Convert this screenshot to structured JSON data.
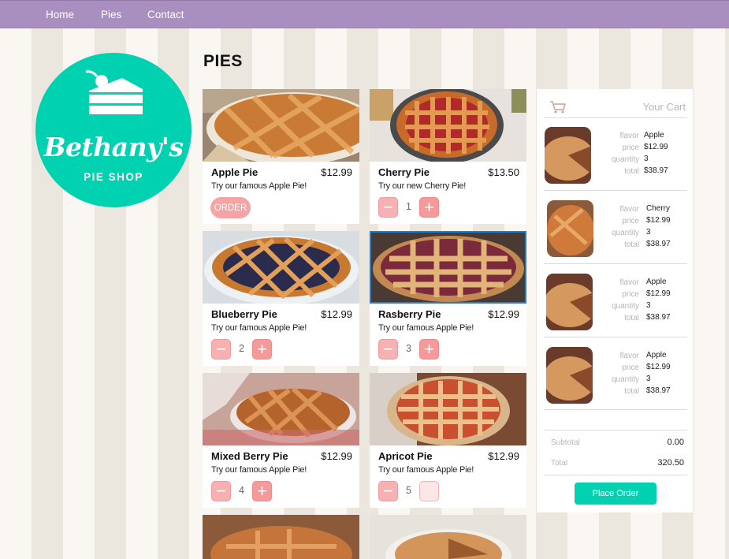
{
  "nav": {
    "home": "Home",
    "pies": "Pies",
    "contact": "Contact"
  },
  "logo": {
    "name": "Bethany's",
    "subtitle": "PIE SHOP"
  },
  "page_title": "PIES",
  "products": [
    {
      "name": "Apple Pie",
      "price": "$12.99",
      "desc": "Try our famous Apple Pie!",
      "action": "ORDER"
    },
    {
      "name": "Cherry Pie",
      "price": "$13.50",
      "desc": "Try our new Cherry Pie!",
      "qty": "1"
    },
    {
      "name": "Blueberry Pie",
      "price": "$12.99",
      "desc": "Try our famous Apple Pie!",
      "qty": "2"
    },
    {
      "name": "Rasberry Pie",
      "price": "$12.99",
      "desc": "Try our famous Apple Pie!",
      "qty": "3"
    },
    {
      "name": "Mixed Berry Pie",
      "price": "$12.99",
      "desc": "Try our famous Apple Pie!",
      "qty": "4"
    },
    {
      "name": "Apricot Pie",
      "price": "$12.99",
      "desc": "Try our famous Apple Pie!",
      "qty": "5"
    }
  ],
  "stepper": {
    "minus": "−",
    "plus": "+"
  },
  "cart": {
    "title": "Your Cart",
    "labels": {
      "flavor": "flavor",
      "price": "price",
      "quantity": "quantity",
      "total": "total"
    },
    "items": [
      {
        "flavor": "Apple",
        "price": "$12.99",
        "quantity": "3",
        "total": "$38.97"
      },
      {
        "flavor": "Cherry",
        "price": "$12.99",
        "quantity": "3",
        "total": "$38.97"
      },
      {
        "flavor": "Apple",
        "price": "$12.99",
        "quantity": "3",
        "total": "$38.97"
      },
      {
        "flavor": "Apple",
        "price": "$12.99",
        "quantity": "3",
        "total": "$38.97"
      }
    ],
    "subtotal_label": "Subtotal",
    "subtotal": "0.00",
    "total_label": "Total",
    "total": "320.50",
    "place_order": "Place Order"
  },
  "colors": {
    "nav": "#a98fc0",
    "accent": "#00d1b0",
    "pink": "#f6a3a3"
  },
  "icons": [
    "cake-slice-icon",
    "cart-icon",
    "minus-icon",
    "plus-icon"
  ]
}
